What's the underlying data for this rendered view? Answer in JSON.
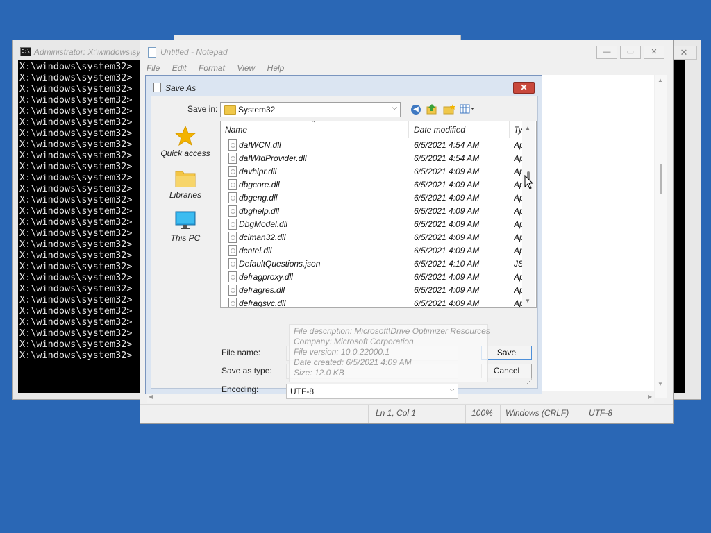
{
  "cmd": {
    "title": "Administrator: X:\\windows\\sy",
    "icon_text": "C:\\",
    "close_glyph": "✕",
    "prompt_lines": [
      "X:\\windows\\system32>",
      "X:\\windows\\system32>",
      "X:\\windows\\system32>",
      "X:\\windows\\system32>",
      "X:\\windows\\system32>",
      "X:\\windows\\system32>",
      "X:\\windows\\system32>",
      "X:\\windows\\system32>",
      "X:\\windows\\system32>",
      "X:\\windows\\system32>",
      "X:\\windows\\system32>",
      "X:\\windows\\system32>",
      "X:\\windows\\system32>",
      "X:\\windows\\system32>",
      "X:\\windows\\system32>",
      "X:\\windows\\system32>",
      "X:\\windows\\system32>",
      "X:\\windows\\system32>",
      "X:\\windows\\system32>",
      "X:\\windows\\system32>",
      "X:\\windows\\system32>",
      "X:\\windows\\system32>",
      "X:\\windows\\system32>",
      "X:\\windows\\system32>",
      "X:\\windows\\system32>",
      "X:\\windows\\system32>",
      "X:\\windows\\system32>"
    ]
  },
  "notepad": {
    "title": "Untitled - Notepad",
    "buttons": {
      "minimize": "—",
      "maximize": "▭",
      "close": "✕"
    },
    "menu": [
      "File",
      "Edit",
      "Format",
      "View",
      "Help"
    ],
    "status": {
      "position": "Ln 1, Col 1",
      "zoom": "100%",
      "line_endings": "Windows (CRLF)",
      "encoding": "UTF-8"
    }
  },
  "save_as": {
    "title": "Save As",
    "close_glyph": "✕",
    "save_in_label": "Save in:",
    "save_in_value": "System32",
    "places": [
      {
        "label": "Quick access",
        "icon": "star-icon"
      },
      {
        "label": "Libraries",
        "icon": "folder-icon"
      },
      {
        "label": "This PC",
        "icon": "monitor-icon"
      }
    ],
    "columns": {
      "name": "Name",
      "date": "Date modified",
      "type": "Ty"
    },
    "files": [
      {
        "name": "dafWCN.dll",
        "date": "6/5/2021 4:54 AM",
        "type": "Ap"
      },
      {
        "name": "dafWfdProvider.dll",
        "date": "6/5/2021 4:54 AM",
        "type": "Ap"
      },
      {
        "name": "davhlpr.dll",
        "date": "6/5/2021 4:09 AM",
        "type": "Ap"
      },
      {
        "name": "dbgcore.dll",
        "date": "6/5/2021 4:09 AM",
        "type": "Ap"
      },
      {
        "name": "dbgeng.dll",
        "date": "6/5/2021 4:09 AM",
        "type": "Ap"
      },
      {
        "name": "dbghelp.dll",
        "date": "6/5/2021 4:09 AM",
        "type": "Ap"
      },
      {
        "name": "DbgModel.dll",
        "date": "6/5/2021 4:09 AM",
        "type": "Ap"
      },
      {
        "name": "dciman32.dll",
        "date": "6/5/2021 4:09 AM",
        "type": "Ap"
      },
      {
        "name": "dcntel.dll",
        "date": "6/5/2021 4:09 AM",
        "type": "Ap"
      },
      {
        "name": "DefaultQuestions.json",
        "date": "6/5/2021 4:10 AM",
        "type": "JS"
      },
      {
        "name": "defragproxy.dll",
        "date": "6/5/2021 4:09 AM",
        "type": "Ap"
      },
      {
        "name": "defragres.dll",
        "date": "6/5/2021 4:09 AM",
        "type": "Ap"
      },
      {
        "name": "defragsvc.dll",
        "date": "6/5/2021 4:09 AM",
        "type": "Ap"
      }
    ],
    "tooltip": [
      "File description: Microsoft\\Drive Optimizer Resources",
      "Company: Microsoft Corporation",
      "File version: 10.0.22000.1",
      "Date created: 6/5/2021 4:09 AM",
      "Size: 12.0 KB"
    ],
    "file_name_label": "File name:",
    "save_as_type_label": "Save as type:",
    "encoding_label": "Encoding:",
    "encoding_value": "UTF-8",
    "save_button": "Save",
    "cancel_button": "Cancel"
  }
}
